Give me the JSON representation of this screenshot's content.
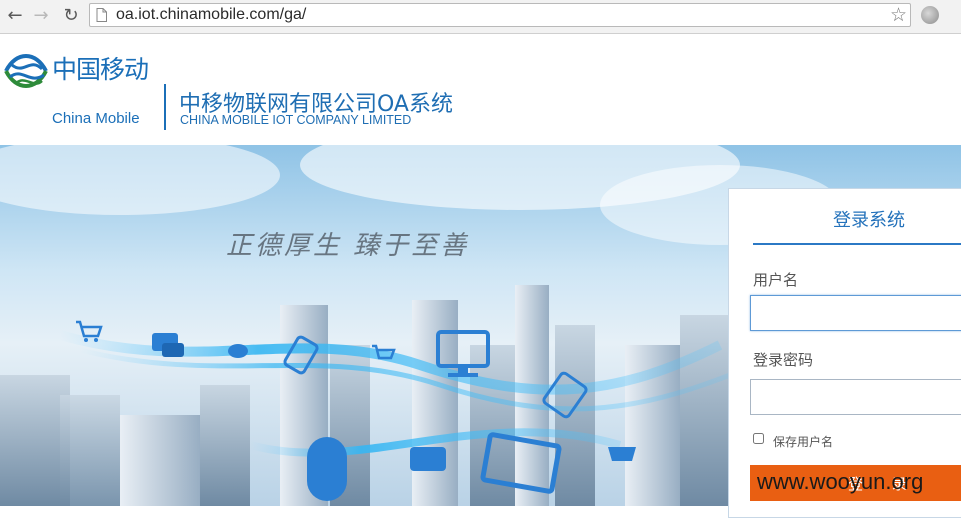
{
  "browser": {
    "url": "oa.iot.chinamobile.com/ga/"
  },
  "header": {
    "brand_cn": "中国移动",
    "brand_en": "China Mobile",
    "system_title": "中移物联网有限公司OA系统",
    "system_subtitle": "CHINA MOBILE IOT COMPANY LIMITED"
  },
  "hero": {
    "slogan": "正德厚生 臻于至善"
  },
  "login": {
    "title": "登录系统",
    "username_label": "用户名",
    "username_value": "",
    "password_label": "登录密码",
    "password_value": "",
    "remember_label": "保存用户名",
    "remember_checked": false,
    "submit_label": "登 录"
  },
  "watermark": "www.wooyun.org",
  "colors": {
    "brand_blue": "#1b6fb8",
    "accent_orange": "#e95f12"
  }
}
